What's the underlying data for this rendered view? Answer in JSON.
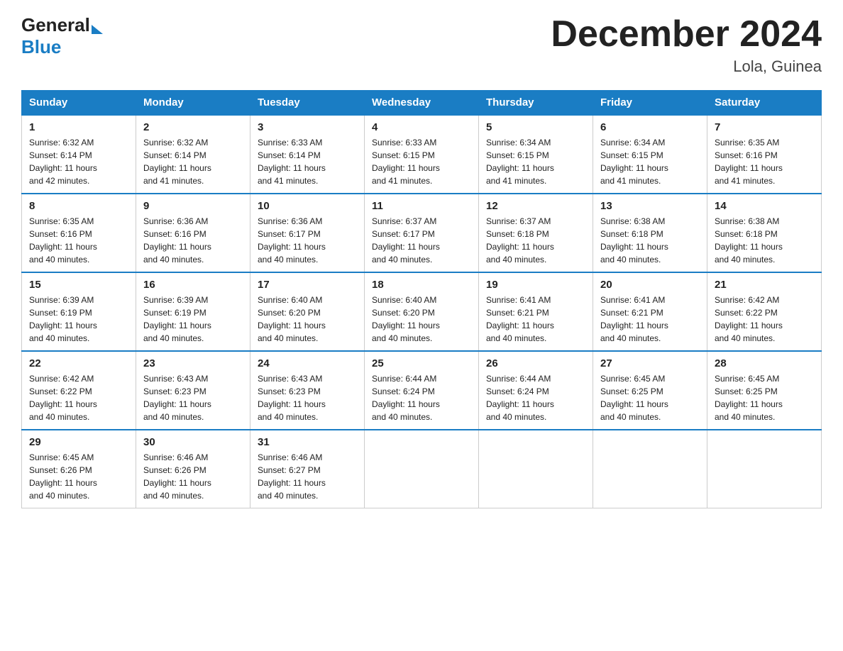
{
  "header": {
    "logo_general": "General",
    "logo_blue": "Blue",
    "month_title": "December 2024",
    "location": "Lola, Guinea"
  },
  "columns": [
    "Sunday",
    "Monday",
    "Tuesday",
    "Wednesday",
    "Thursday",
    "Friday",
    "Saturday"
  ],
  "weeks": [
    [
      {
        "day": "1",
        "sunrise": "6:32 AM",
        "sunset": "6:14 PM",
        "daylight": "11 hours and 42 minutes."
      },
      {
        "day": "2",
        "sunrise": "6:32 AM",
        "sunset": "6:14 PM",
        "daylight": "11 hours and 41 minutes."
      },
      {
        "day": "3",
        "sunrise": "6:33 AM",
        "sunset": "6:14 PM",
        "daylight": "11 hours and 41 minutes."
      },
      {
        "day": "4",
        "sunrise": "6:33 AM",
        "sunset": "6:15 PM",
        "daylight": "11 hours and 41 minutes."
      },
      {
        "day": "5",
        "sunrise": "6:34 AM",
        "sunset": "6:15 PM",
        "daylight": "11 hours and 41 minutes."
      },
      {
        "day": "6",
        "sunrise": "6:34 AM",
        "sunset": "6:15 PM",
        "daylight": "11 hours and 41 minutes."
      },
      {
        "day": "7",
        "sunrise": "6:35 AM",
        "sunset": "6:16 PM",
        "daylight": "11 hours and 41 minutes."
      }
    ],
    [
      {
        "day": "8",
        "sunrise": "6:35 AM",
        "sunset": "6:16 PM",
        "daylight": "11 hours and 40 minutes."
      },
      {
        "day": "9",
        "sunrise": "6:36 AM",
        "sunset": "6:16 PM",
        "daylight": "11 hours and 40 minutes."
      },
      {
        "day": "10",
        "sunrise": "6:36 AM",
        "sunset": "6:17 PM",
        "daylight": "11 hours and 40 minutes."
      },
      {
        "day": "11",
        "sunrise": "6:37 AM",
        "sunset": "6:17 PM",
        "daylight": "11 hours and 40 minutes."
      },
      {
        "day": "12",
        "sunrise": "6:37 AM",
        "sunset": "6:18 PM",
        "daylight": "11 hours and 40 minutes."
      },
      {
        "day": "13",
        "sunrise": "6:38 AM",
        "sunset": "6:18 PM",
        "daylight": "11 hours and 40 minutes."
      },
      {
        "day": "14",
        "sunrise": "6:38 AM",
        "sunset": "6:18 PM",
        "daylight": "11 hours and 40 minutes."
      }
    ],
    [
      {
        "day": "15",
        "sunrise": "6:39 AM",
        "sunset": "6:19 PM",
        "daylight": "11 hours and 40 minutes."
      },
      {
        "day": "16",
        "sunrise": "6:39 AM",
        "sunset": "6:19 PM",
        "daylight": "11 hours and 40 minutes."
      },
      {
        "day": "17",
        "sunrise": "6:40 AM",
        "sunset": "6:20 PM",
        "daylight": "11 hours and 40 minutes."
      },
      {
        "day": "18",
        "sunrise": "6:40 AM",
        "sunset": "6:20 PM",
        "daylight": "11 hours and 40 minutes."
      },
      {
        "day": "19",
        "sunrise": "6:41 AM",
        "sunset": "6:21 PM",
        "daylight": "11 hours and 40 minutes."
      },
      {
        "day": "20",
        "sunrise": "6:41 AM",
        "sunset": "6:21 PM",
        "daylight": "11 hours and 40 minutes."
      },
      {
        "day": "21",
        "sunrise": "6:42 AM",
        "sunset": "6:22 PM",
        "daylight": "11 hours and 40 minutes."
      }
    ],
    [
      {
        "day": "22",
        "sunrise": "6:42 AM",
        "sunset": "6:22 PM",
        "daylight": "11 hours and 40 minutes."
      },
      {
        "day": "23",
        "sunrise": "6:43 AM",
        "sunset": "6:23 PM",
        "daylight": "11 hours and 40 minutes."
      },
      {
        "day": "24",
        "sunrise": "6:43 AM",
        "sunset": "6:23 PM",
        "daylight": "11 hours and 40 minutes."
      },
      {
        "day": "25",
        "sunrise": "6:44 AM",
        "sunset": "6:24 PM",
        "daylight": "11 hours and 40 minutes."
      },
      {
        "day": "26",
        "sunrise": "6:44 AM",
        "sunset": "6:24 PM",
        "daylight": "11 hours and 40 minutes."
      },
      {
        "day": "27",
        "sunrise": "6:45 AM",
        "sunset": "6:25 PM",
        "daylight": "11 hours and 40 minutes."
      },
      {
        "day": "28",
        "sunrise": "6:45 AM",
        "sunset": "6:25 PM",
        "daylight": "11 hours and 40 minutes."
      }
    ],
    [
      {
        "day": "29",
        "sunrise": "6:45 AM",
        "sunset": "6:26 PM",
        "daylight": "11 hours and 40 minutes."
      },
      {
        "day": "30",
        "sunrise": "6:46 AM",
        "sunset": "6:26 PM",
        "daylight": "11 hours and 40 minutes."
      },
      {
        "day": "31",
        "sunrise": "6:46 AM",
        "sunset": "6:27 PM",
        "daylight": "11 hours and 40 minutes."
      },
      null,
      null,
      null,
      null
    ]
  ],
  "labels": {
    "sunrise": "Sunrise:",
    "sunset": "Sunset:",
    "daylight": "Daylight:"
  }
}
